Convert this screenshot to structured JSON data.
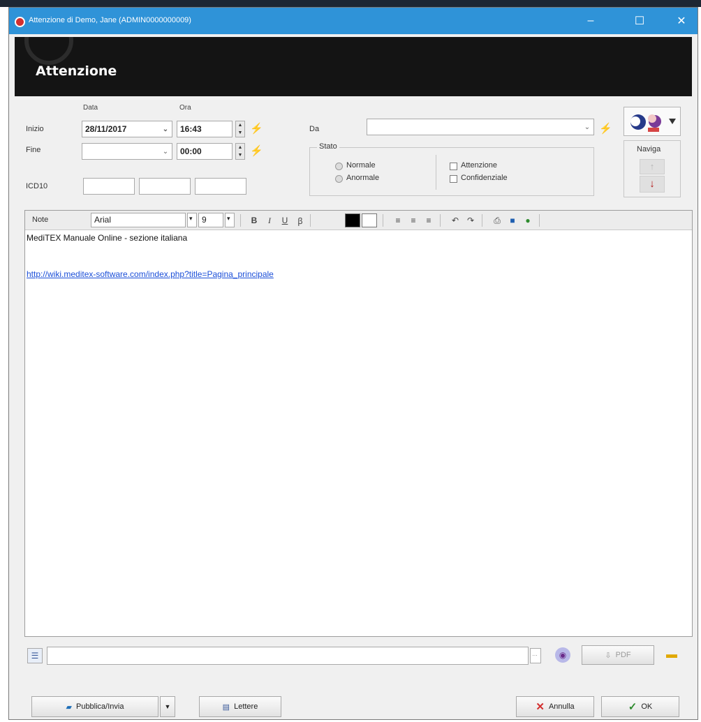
{
  "window": {
    "title": "Attenzione di Demo, Jane (ADMIN0000000009)",
    "icons": {
      "app": "app-icon",
      "minimize": "minimize-icon",
      "maximize": "maximize-icon",
      "close": "close-icon"
    },
    "minimize_glyph": "–",
    "maximize_glyph": "☐",
    "close_glyph": "✕"
  },
  "header": {
    "title": "Attenzione"
  },
  "form": {
    "col_data": "Data",
    "col_ora": "Ora",
    "inizio_label": "Inizio",
    "inizio_date": "28/11/2017",
    "inizio_time": "16:43",
    "fine_label": "Fine",
    "fine_date": "",
    "fine_time": "00:00",
    "icd10_label": "ICD10",
    "icd10_values": [
      "",
      "",
      ""
    ],
    "da_label": "Da",
    "da_value": "",
    "stato": {
      "legend": "Stato",
      "normale": "Normale",
      "anormale": "Anormale",
      "attenzione": "Attenzione",
      "confidenziale": "Confidenziale"
    },
    "naviga_label": "Naviga"
  },
  "toolbar": {
    "note_label": "Note",
    "font_value": "Arial",
    "size_value": "9",
    "bold": "B",
    "italic": "I",
    "underline": "U"
  },
  "editor": {
    "line1": "MediTEX Manuale Online - sezione italiana",
    "link": "http://wiki.meditex-software.com/index.php?title=Pagina_principale"
  },
  "footer": {
    "path_value": "",
    "pdf_label": "PDF",
    "pubblica_label": "Pubblica/Invia",
    "lettere_label": "Lettere",
    "annulla_label": "Annulla",
    "ok_label": "OK"
  },
  "colors": {
    "titlebar": "#2f93d8",
    "header_band": "#141414",
    "link": "#1a4ed8",
    "annulla_x": "#d32f2f",
    "ok_check": "#2e8b2e"
  }
}
